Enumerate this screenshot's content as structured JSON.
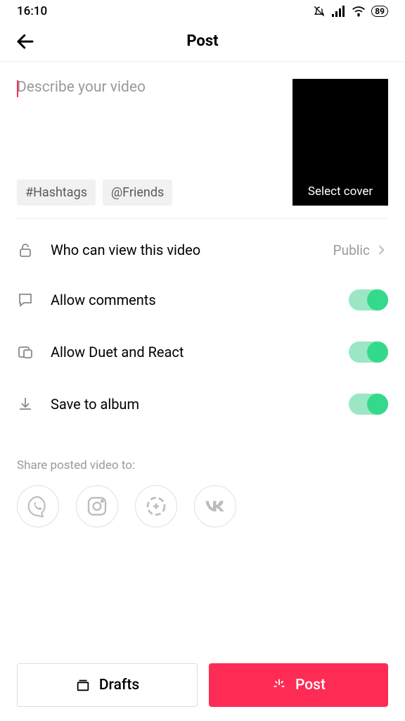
{
  "status": {
    "time": "16:10",
    "battery": "89"
  },
  "header": {
    "title": "Post"
  },
  "compose": {
    "placeholder": "Describe your video",
    "chips": {
      "hashtags": "#Hashtags",
      "friends": "@Friends"
    },
    "cover_label": "Select cover"
  },
  "settings": {
    "privacy": {
      "label": "Who can view this video",
      "value": "Public"
    },
    "comments": {
      "label": "Allow comments"
    },
    "duet": {
      "label": "Allow Duet and React"
    },
    "save": {
      "label": "Save to album"
    }
  },
  "share": {
    "label": "Share posted video to:"
  },
  "buttons": {
    "drafts": "Drafts",
    "post": "Post"
  }
}
